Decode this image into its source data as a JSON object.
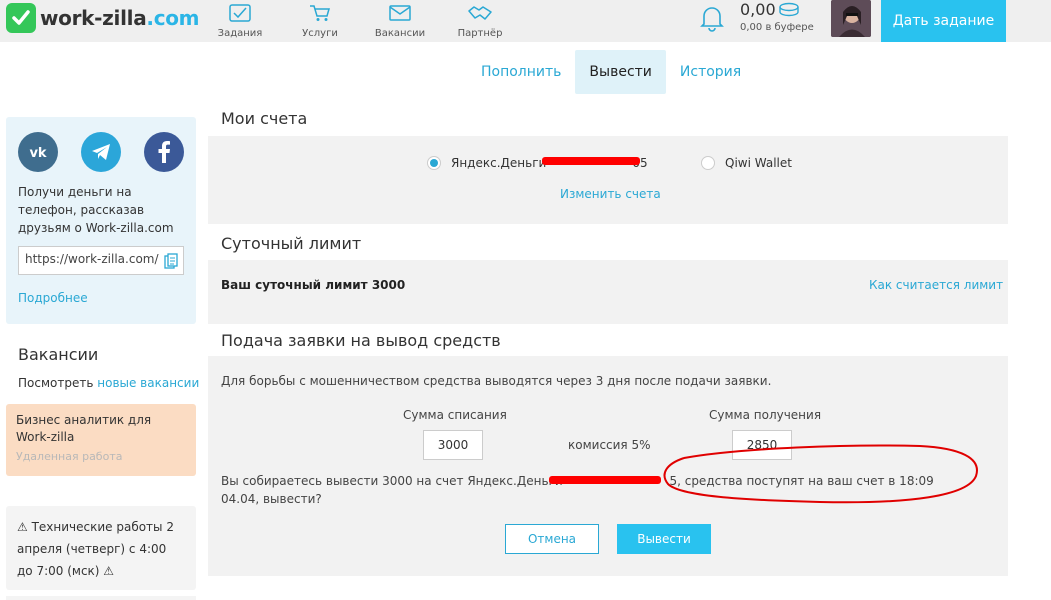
{
  "header": {
    "logo_text": "work-zilla",
    "logo_domain": ".com",
    "nav": [
      {
        "label": "Задания",
        "icon": "tasks-icon"
      },
      {
        "label": "Услуги",
        "icon": "cart-icon"
      },
      {
        "label": "Вакансии",
        "icon": "mail-icon"
      },
      {
        "label": "Партнёр",
        "icon": "handshake-icon"
      }
    ],
    "balance": "0,00",
    "buffer": "0,00 в буфере",
    "cta_label": "Дать задание"
  },
  "tabs": [
    {
      "label": "Пополнить",
      "active": false
    },
    {
      "label": "Вывести",
      "active": true
    },
    {
      "label": "История",
      "active": false
    }
  ],
  "sidebar": {
    "share_text": "Получи деньги на телефон, рассказав друзьям о Work-zilla.com",
    "share_url": "https://work-zilla.com/",
    "more_link": "Подробнее",
    "vacancies_title": "Вакансии",
    "vacancies_see": "Посмотреть",
    "vacancies_new_link": "новые вакансии",
    "vacancy_card": {
      "title": "Бизнес аналитик для Work-zilla",
      "subtitle": "Удаленная работа"
    },
    "notice": "⚠ Технические работы 2 апреля (четверг) с 4:00 до 7:00 (мск) ⚠"
  },
  "accounts": {
    "title": "Мои счета",
    "option1_prefix": "Яндекс.Деньги",
    "option1_suffix": "05",
    "option1_selected": true,
    "option2": "Qiwi Wallet",
    "change_link": "Изменить счета"
  },
  "limit": {
    "title": "Суточный лимит",
    "text": "Ваш суточный лимит 3000",
    "how_link": "Как считается лимит"
  },
  "withdraw": {
    "title": "Подача заявки на вывод средств",
    "fraud_note": "Для борьбы с мошенничеством средства выводятся через 3 дня после подачи заявки.",
    "debit_label": "Сумма списания",
    "debit_value": "3000",
    "commission": "комиссия 5%",
    "receive_label": "Сумма получения",
    "receive_value": "2850",
    "confirm_prefix": "Вы собираетесь вывести 3000 на счет Яндекс.Деньги",
    "confirm_suffix": "5, средства поступят на ваш счет в 18:09 04.04, вывести?",
    "cancel_label": "Отмена",
    "submit_label": "Вывести"
  },
  "colors": {
    "accent": "#29c2ef",
    "link": "#2aa8d4",
    "annotation": "#e00000"
  }
}
